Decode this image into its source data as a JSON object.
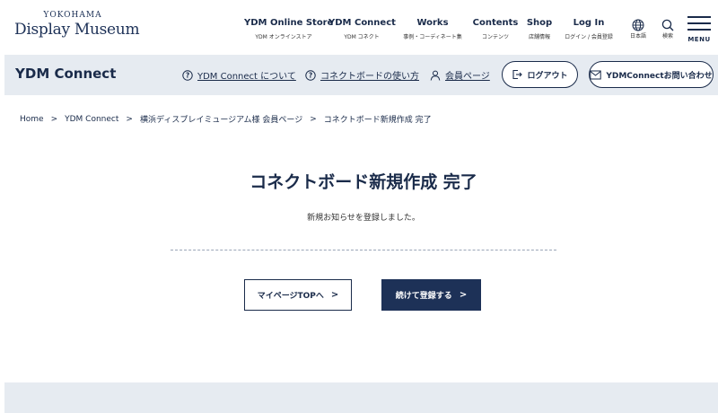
{
  "logo": {
    "top": "YOKOHAMA",
    "main": "Display Museum"
  },
  "nav": [
    {
      "label": "YDM Online Store",
      "sub": "YDM オンラインストア"
    },
    {
      "label": "YDM Connect",
      "sub": "YDM コネクト"
    },
    {
      "label": "Works",
      "sub": "事例・コーディネート集"
    },
    {
      "label": "Contents",
      "sub": "コンテンツ"
    },
    {
      "label": "Shop",
      "sub": "店舗情報"
    },
    {
      "label": "Log In",
      "sub": "ログイン / 会員登録"
    }
  ],
  "language": {
    "label": "日本語",
    "icon": "globe-icon"
  },
  "search": {
    "label": "検索",
    "icon": "search-icon"
  },
  "menu": {
    "label": "MENU",
    "icon": "hamburger-icon"
  },
  "subheader": {
    "title": "YDM Connect",
    "links": [
      {
        "label": "YDM Connect について",
        "icon": "question-circle-icon"
      },
      {
        "label": "コネクトボードの使い方",
        "icon": "question-circle-icon"
      },
      {
        "label": "会員ページ",
        "icon": "user-icon"
      }
    ],
    "logout": {
      "label": "ログアウト",
      "icon": "logout-icon"
    },
    "contact": {
      "label": "YDMConnectお問い合わせ",
      "icon": "mail-icon"
    }
  },
  "breadcrumb": {
    "items": [
      "Home",
      "YDM Connect",
      "横浜ディスプレイミュージアム様 会員ページ"
    ],
    "current": "コネクトボード新規作成 完了",
    "separator": ">"
  },
  "main": {
    "title": "コネクトボード新規作成 完了",
    "message": "新規お知らせを登録しました。",
    "mypage_button": "マイページTOPへ",
    "continue_button": "続けて登録する",
    "chevron": ">"
  },
  "colors": {
    "navy": "#1d3157",
    "band": "#e6ebf1",
    "text": "#1a2b4a"
  }
}
